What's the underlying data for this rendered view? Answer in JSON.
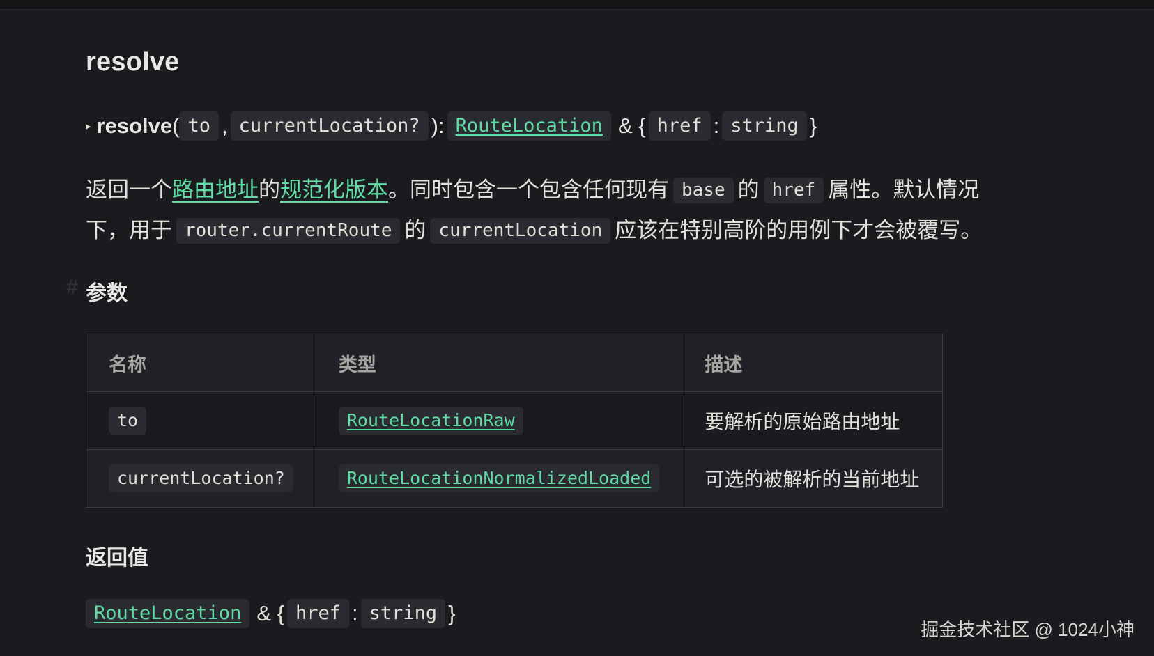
{
  "heading": "resolve",
  "signature": {
    "caret": "▸",
    "name": "resolve",
    "open_paren": "(",
    "param1": "to",
    "comma": ",",
    "param2": "currentLocation?",
    "close": "):",
    "return_type": "RouteLocation",
    "amp_brace": "& {",
    "href_key": "href",
    "colon": ":",
    "string_type": "string",
    "close_brace": "}"
  },
  "description": {
    "t1": "返回一个",
    "link1": "路由地址",
    "t2": "的",
    "link2": "规范化版本",
    "t3": "。同时包含一个包含任何现有",
    "code1": "base",
    "t4": "的",
    "code2": "href",
    "t5": "属性。默认情况",
    "t6": "下，用于",
    "code3": "router.currentRoute",
    "t7": "的",
    "code4": "currentLocation",
    "t8": "应该在特别高阶的用例下才会被覆写。"
  },
  "params_section": {
    "anchor": "#",
    "title": "参数",
    "headers": [
      "名称",
      "类型",
      "描述"
    ],
    "rows": [
      {
        "name": "to",
        "type": "RouteLocationRaw",
        "desc": "要解析的原始路由地址"
      },
      {
        "name": "currentLocation?",
        "type": "RouteLocationNormalizedLoaded",
        "desc": "可选的被解析的当前地址"
      }
    ]
  },
  "returns_section": {
    "title": "返回值",
    "return_type": "RouteLocation",
    "amp_brace": "& {",
    "href_key": "href",
    "colon": ":",
    "string_type": "string",
    "close_brace": "}"
  },
  "watermark": "掘金技术社区 @ 1024小神",
  "colors": {
    "background": "#1b1b1f",
    "link": "#5fdba3",
    "code_bg": "#2a2b31"
  }
}
